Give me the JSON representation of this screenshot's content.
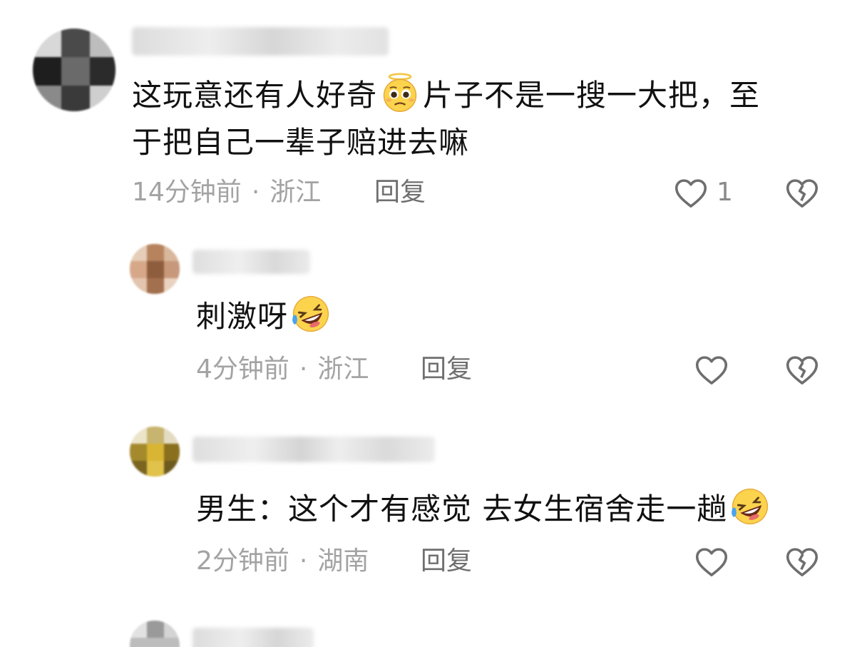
{
  "comments": [
    {
      "text_line1_a": "这玩意还有人好奇",
      "text_line1_b": "片子不是一搜一大把，至",
      "text_line2": "于把自己一辈子赔进去嘛",
      "time": "14分钟前",
      "location": "浙江",
      "reply_label": "回复",
      "like_count": "1",
      "emoji": "pleading-face-with-halo-emoji"
    },
    {
      "text": "刺激呀",
      "time": "4分钟前",
      "location": "浙江",
      "reply_label": "回复",
      "emoji": "rolling-on-floor-laughing-emoji"
    },
    {
      "text": "男生：这个才有感觉 去女生宿舍走一趟",
      "time": "2分钟前",
      "location": "湖南",
      "reply_label": "回复",
      "emoji": "rolling-on-floor-laughing-emoji"
    }
  ],
  "separator": "·",
  "colors": {
    "text": "#111111",
    "meta": "#a3a3a3",
    "reply": "#6f6f6f",
    "icon": "#6e6e6e"
  }
}
